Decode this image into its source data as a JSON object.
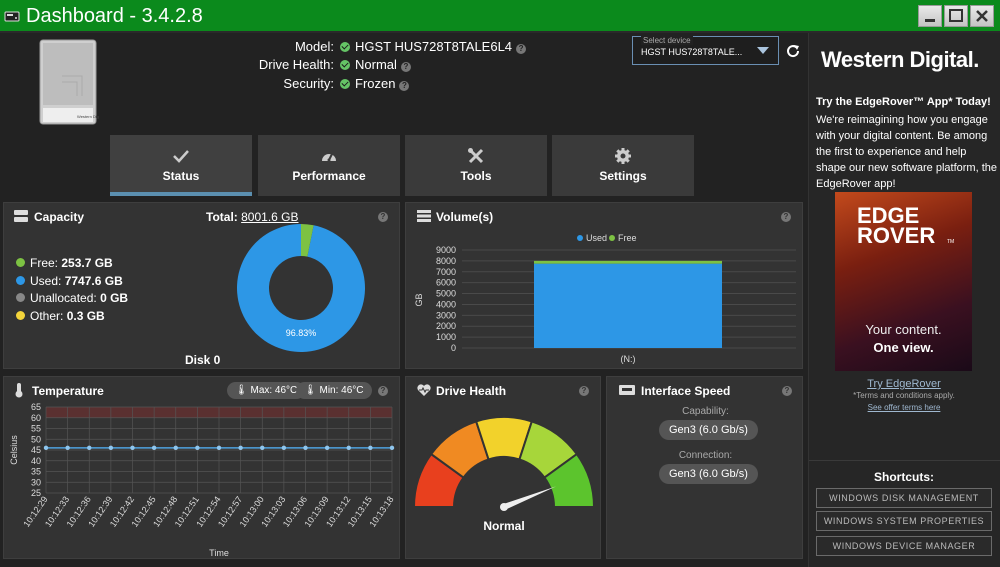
{
  "window": {
    "title": "Dashboard - 3.4.2.8"
  },
  "drive_info": {
    "model_label": "Model:",
    "model_value": "HGST HUS728T8TALE6L4",
    "health_label": "Drive Health:",
    "health_value": "Normal",
    "security_label": "Security:",
    "security_value": "Frozen"
  },
  "device_select": {
    "label": "Select device",
    "value": "HGST HUS728T8TALE..."
  },
  "tabs": [
    {
      "label": "Status",
      "icon": "checkmark-icon",
      "active": true
    },
    {
      "label": "Performance",
      "icon": "speedometer-icon",
      "active": false
    },
    {
      "label": "Tools",
      "icon": "tools-icon",
      "active": false
    },
    {
      "label": "Settings",
      "icon": "gear-icon",
      "active": false
    }
  ],
  "capacity": {
    "title": "Capacity",
    "total_label": "Total:",
    "total_value": "8001.6 GB",
    "free_label": "Free:",
    "free_value": "253.7 GB",
    "used_label": "Used:",
    "used_value": "7747.6 GB",
    "unalloc_label": "Unallocated:",
    "unalloc_value": "0 GB",
    "other_label": "Other:",
    "other_value": "0.3 GB",
    "donut_pct_label": "96.83%",
    "disk_label": "Disk 0",
    "colors": {
      "free": "#7dc243",
      "used": "#2d97e6",
      "unallocated": "#888888",
      "other": "#f3d43b"
    }
  },
  "volumes": {
    "title": "Volume(s)",
    "legend_used": "Used",
    "legend_free": "Free",
    "y_axis_label": "GB",
    "x_label": "(N:)"
  },
  "temperature": {
    "title": "Temperature",
    "max_label": "Max: 46°C",
    "min_label": "Min: 46°C",
    "y_axis_label": "Celsius",
    "x_axis_label": "Time"
  },
  "drive_health": {
    "title": "Drive Health",
    "status": "Normal",
    "gauge_level": 0.88
  },
  "interface_speed": {
    "title": "Interface Speed",
    "capability_label": "Capability:",
    "capability_value": "Gen3 (6.0 Gb/s)",
    "connection_label": "Connection:",
    "connection_value": "Gen3 (6.0 Gb/s)"
  },
  "sidebar": {
    "brand": "Western Digital.",
    "promo_title": "Try the EdgeRover™ App* Today!",
    "promo_text": "We're reimagining how you engage with your digital content. Be among the first to experience and help shape our new software platform, the EdgeRover app!",
    "banner_line1": "EDGE",
    "banner_line2": "ROVER",
    "banner_tm": "TM",
    "banner_tag1": "Your content.",
    "banner_tag2": "One view.",
    "try_link": "Try EdgeRover",
    "terms_text": "*Terms and conditions apply.",
    "offer_link": "See offer terms here",
    "shortcuts_title": "Shortcuts:",
    "shortcuts": [
      "WINDOWS DISK MANAGEMENT",
      "WINDOWS SYSTEM PROPERTIES",
      "WINDOWS DEVICE MANAGER"
    ]
  },
  "chart_data": [
    {
      "type": "pie",
      "title": "Capacity",
      "categories": [
        "Free",
        "Used",
        "Unallocated",
        "Other"
      ],
      "values": [
        253.7,
        7747.6,
        0,
        0.3
      ],
      "unit": "GB",
      "colors": [
        "#7dc243",
        "#2d97e6",
        "#888888",
        "#f3d43b"
      ]
    },
    {
      "type": "bar",
      "title": "Volume(s)",
      "categories": [
        "(N:)"
      ],
      "series": [
        {
          "name": "Used",
          "values": [
            7747.6
          ],
          "color": "#2d97e6"
        },
        {
          "name": "Free",
          "values": [
            253.7
          ],
          "color": "#7dc243"
        }
      ],
      "ylabel": "GB",
      "ylim": [
        0,
        9000
      ],
      "yticks": [
        0,
        1000,
        2000,
        3000,
        4000,
        5000,
        6000,
        7000,
        8000,
        9000
      ],
      "stacked": true,
      "legend": "top"
    },
    {
      "type": "line",
      "title": "Temperature",
      "x": [
        "10:12:29",
        "10:12:33",
        "10:12:36",
        "10:12:39",
        "10:12:42",
        "10:12:45",
        "10:12:48",
        "10:12:51",
        "10:12:54",
        "10:12:57",
        "10:13:00",
        "10:13:03",
        "10:13:06",
        "10:13:09",
        "10:13:12",
        "10:13:15",
        "10:13:18"
      ],
      "series": [
        {
          "values": [
            46,
            46,
            46,
            46,
            46,
            46,
            46,
            46,
            46,
            46,
            46,
            46,
            46,
            46,
            46,
            46,
            46
          ],
          "color": "#4fa3e0"
        }
      ],
      "ylabel": "Celsius",
      "xlabel": "Time",
      "ylim": [
        25,
        65
      ],
      "yticks": [
        25,
        30,
        35,
        40,
        45,
        50,
        55,
        60,
        65
      ],
      "grid": true
    }
  ]
}
